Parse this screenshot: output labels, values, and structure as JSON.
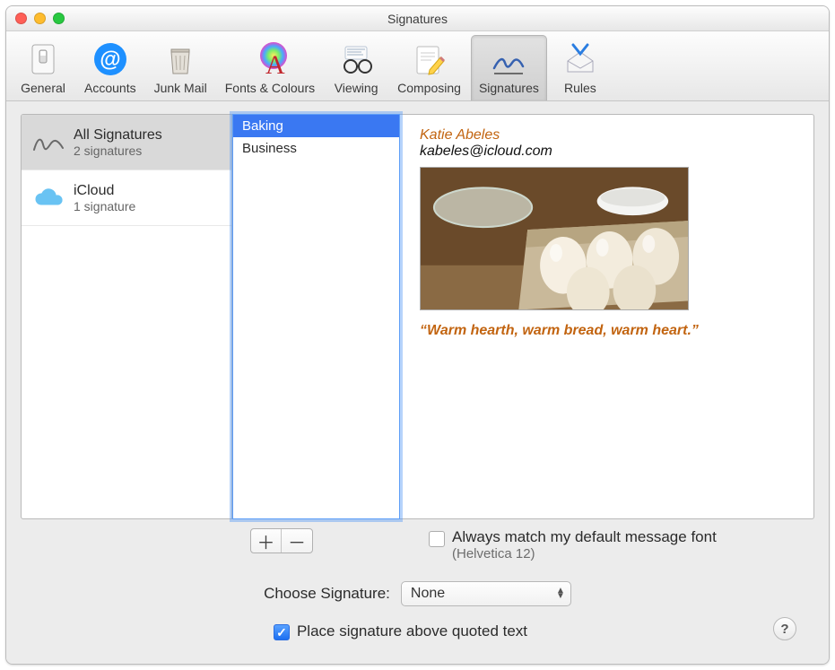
{
  "window": {
    "title": "Signatures"
  },
  "toolbar": {
    "items": [
      {
        "label": "General"
      },
      {
        "label": "Accounts"
      },
      {
        "label": "Junk Mail"
      },
      {
        "label": "Fonts & Colours"
      },
      {
        "label": "Viewing"
      },
      {
        "label": "Composing"
      },
      {
        "label": "Signatures",
        "selected": true
      },
      {
        "label": "Rules"
      }
    ]
  },
  "accounts": [
    {
      "name": "All Signatures",
      "subtext": "2 signatures",
      "selected": true,
      "icon": "signature"
    },
    {
      "name": "iCloud",
      "subtext": "1 signature",
      "icon": "icloud"
    }
  ],
  "signatures": [
    {
      "name": "Baking",
      "selected": true
    },
    {
      "name": "Business"
    }
  ],
  "preview": {
    "name": "Katie Abeles",
    "email": "kabeles@icloud.com",
    "quote": "“Warm hearth, warm bread, warm heart.”"
  },
  "buttons": {
    "add": "＋",
    "remove": "－"
  },
  "matchFont": {
    "label": "Always match my default message font",
    "sub": "(Helvetica 12)",
    "checked": false
  },
  "chooseSig": {
    "label": "Choose Signature:",
    "value": "None"
  },
  "placeAbove": {
    "label": "Place signature above quoted text",
    "checked": true
  }
}
